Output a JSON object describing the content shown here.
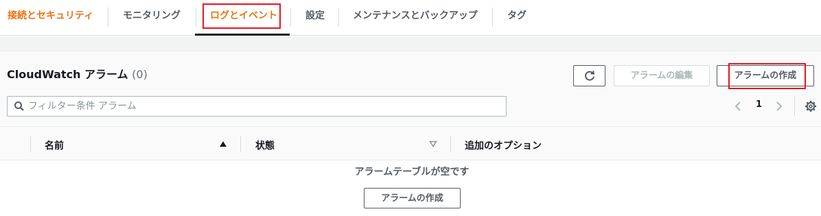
{
  "tabs": [
    {
      "label": "接続とセキュリティ"
    },
    {
      "label": "モニタリング"
    },
    {
      "label": "ログとイベント"
    },
    {
      "label": "設定"
    },
    {
      "label": "メンテナンスとバックアップ"
    },
    {
      "label": "タグ"
    }
  ],
  "alarms": {
    "title": "CloudWatch アラーム",
    "count": "(0)",
    "refresh_icon": "refresh-icon",
    "edit_label": "アラームの編集",
    "create_label": "アラームの作成",
    "search_placeholder": "フィルター条件 アラーム",
    "page": "1",
    "columns": [
      "名前",
      "状態",
      "追加のオプション"
    ],
    "empty_message": "アラームテーブルが空です",
    "empty_create_label": "アラームの作成"
  },
  "colors": {
    "accent_orange": "#ec7211",
    "highlight_red": "#e8141b"
  }
}
